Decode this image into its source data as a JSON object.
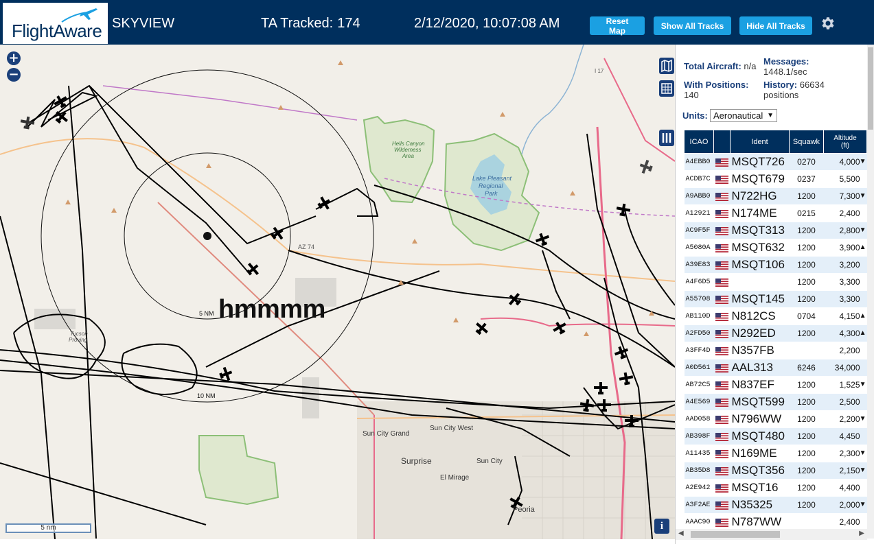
{
  "header": {
    "logo_text": "FlightAware",
    "app_title": "SKYVIEW",
    "tracked_label": "TA Tracked:",
    "tracked_count": "174",
    "datetime": "2/12/2020, 10:07:08 AM",
    "buttons": {
      "reset": "Reset Map",
      "show_all": "Show All Tracks",
      "hide_all": "Hide All Tracks"
    },
    "settings_icon": "gear-icon"
  },
  "map": {
    "zoom_in": "+",
    "zoom_out": "−",
    "scale_label": "5 nm",
    "annotation": "hmmmm",
    "info_button": "i",
    "controls": [
      "map-layers-icon",
      "grid-icon",
      "columns-icon"
    ],
    "labels": {
      "hells_canyon_1": "Hells Canyon",
      "hells_canyon_2": "Wilderness",
      "hells_canyon_3": "Area",
      "lake_1": "Lake Pleasant",
      "lake_2": "Regional",
      "lake_3": "Park",
      "az74": "AZ 74",
      "ring_5nm": "5 NM",
      "ring_10nm": "10 NM",
      "sun_city_grand": "Sun City Grand",
      "sun_city_west": "Sun City West",
      "surprise": "Surprise",
      "sun_city": "Sun City",
      "el_mirage": "El Mirage",
      "peoria": "Peoria",
      "i17": "I 17",
      "proving_1": "Tucson",
      "proving_2": "Proving"
    }
  },
  "panel": {
    "total_aircraft_label": "Total Aircraft:",
    "total_aircraft_value": "n/a",
    "with_positions_label": "With Positions:",
    "with_positions_value": "140",
    "messages_label": "Messages:",
    "messages_value": "1448.1/sec",
    "history_label": "History:",
    "history_value": "66634",
    "history_unit": "positions",
    "units_label": "Units:",
    "units_value": "Aeronautical",
    "columns": {
      "icao": "ICAO",
      "ident": "Ident",
      "squawk": "Squawk",
      "altitude_1": "Altitude",
      "altitude_2": "(ft)"
    },
    "rows": [
      {
        "icao": "A4EBB0",
        "ident": "MSQT726",
        "squawk": "0270",
        "altitude": "4,000",
        "trend": "▼"
      },
      {
        "icao": "ACDB7C",
        "ident": "MSQT679",
        "squawk": "0237",
        "altitude": "5,500",
        "trend": ""
      },
      {
        "icao": "A9ABB0",
        "ident": "N722HG",
        "squawk": "1200",
        "altitude": "7,300",
        "trend": "▼"
      },
      {
        "icao": "A12921",
        "ident": "N174ME",
        "squawk": "0215",
        "altitude": "2,400",
        "trend": ""
      },
      {
        "icao": "AC9F5F",
        "ident": "MSQT313",
        "squawk": "1200",
        "altitude": "2,800",
        "trend": "▼"
      },
      {
        "icao": "A5080A",
        "ident": "MSQT632",
        "squawk": "1200",
        "altitude": "3,900",
        "trend": "▲"
      },
      {
        "icao": "A39E83",
        "ident": "MSQT106",
        "squawk": "1200",
        "altitude": "3,200",
        "trend": ""
      },
      {
        "icao": "A4F6D5",
        "ident": "",
        "squawk": "1200",
        "altitude": "3,300",
        "trend": ""
      },
      {
        "icao": "A55708",
        "ident": "MSQT145",
        "squawk": "1200",
        "altitude": "3,300",
        "trend": ""
      },
      {
        "icao": "AB110D",
        "ident": "N812CS",
        "squawk": "0704",
        "altitude": "4,150",
        "trend": "▲"
      },
      {
        "icao": "A2FD50",
        "ident": "N292ED",
        "squawk": "1200",
        "altitude": "4,300",
        "trend": "▲"
      },
      {
        "icao": "A3FF4D",
        "ident": "N357FB",
        "squawk": "",
        "altitude": "2,200",
        "trend": ""
      },
      {
        "icao": "A0D561",
        "ident": "AAL313",
        "squawk": "6246",
        "altitude": "34,000",
        "trend": ""
      },
      {
        "icao": "AB72C5",
        "ident": "N837EF",
        "squawk": "1200",
        "altitude": "1,525",
        "trend": "▼"
      },
      {
        "icao": "A4E569",
        "ident": "MSQT599",
        "squawk": "1200",
        "altitude": "2,500",
        "trend": ""
      },
      {
        "icao": "AAD058",
        "ident": "N796WW",
        "squawk": "1200",
        "altitude": "2,200",
        "trend": "▼"
      },
      {
        "icao": "AB398F",
        "ident": "MSQT480",
        "squawk": "1200",
        "altitude": "4,450",
        "trend": ""
      },
      {
        "icao": "A11435",
        "ident": "N169ME",
        "squawk": "1200",
        "altitude": "2,300",
        "trend": "▼"
      },
      {
        "icao": "AB35D8",
        "ident": "MSQT356",
        "squawk": "1200",
        "altitude": "2,150",
        "trend": "▼"
      },
      {
        "icao": "A2E942",
        "ident": "MSQT16",
        "squawk": "1200",
        "altitude": "4,400",
        "trend": ""
      },
      {
        "icao": "A3F2AE",
        "ident": "N35325",
        "squawk": "1200",
        "altitude": "2,000",
        "trend": "▼"
      },
      {
        "icao": "AAAC90",
        "ident": "N787WW",
        "squawk": "",
        "altitude": "2,400",
        "trend": ""
      }
    ]
  },
  "colors": {
    "header_bg": "#002f5d",
    "button_bg": "#1ba0e2",
    "row_alt": "#e4eff9",
    "map_bg": "#f2efe9",
    "park_green": "#8cbf77",
    "water": "#aad3df"
  }
}
